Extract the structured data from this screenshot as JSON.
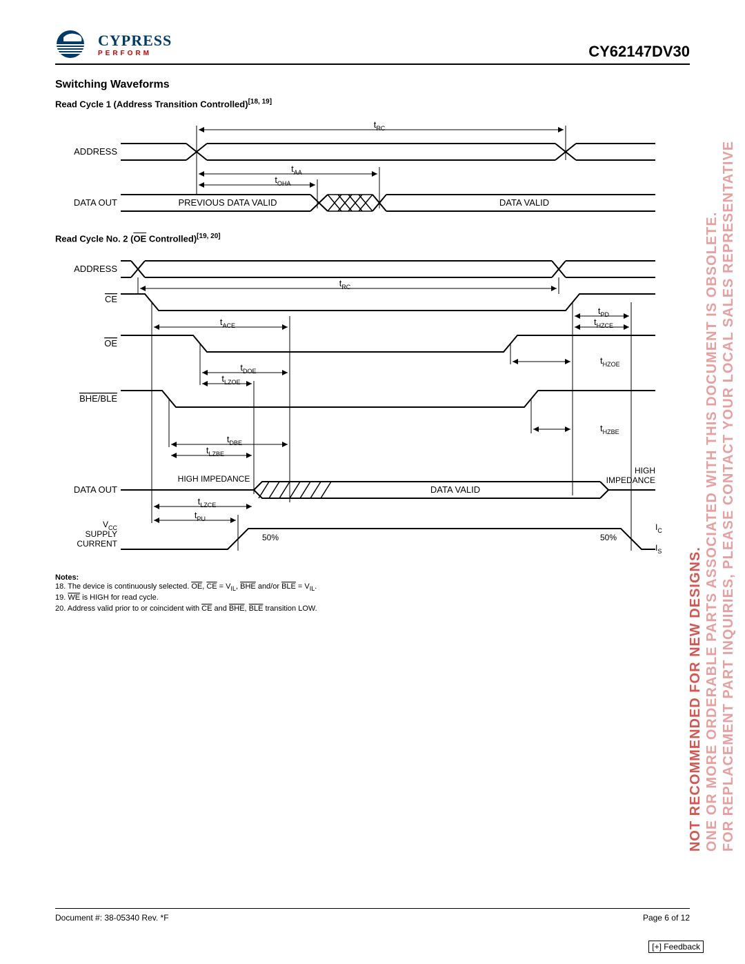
{
  "header": {
    "logo_brand": "CYPRESS",
    "logo_tagline": "PERFORM",
    "part_number": "CY62147DV30"
  },
  "section_title": "Switching Waveforms",
  "cycle1": {
    "title_prefix": "Read Cycle 1 (Address Transition Controlled)",
    "title_refs": "[18, 19]",
    "labels": {
      "address": "ADDRESS",
      "data_out": "DATA OUT",
      "prev_valid": "PREVIOUS DATA VALID",
      "data_valid": "DATA VALID",
      "t_rc": "t",
      "t_rc_sub": "RC",
      "t_aa": "t",
      "t_aa_sub": "AA",
      "t_oha": "t",
      "t_oha_sub": "OHA"
    }
  },
  "cycle2": {
    "title_prefix": "Read Cycle No. 2 (",
    "title_oe": "OE",
    "title_suffix": " Controlled)",
    "title_refs": "[19, 20]",
    "labels": {
      "address": "ADDRESS",
      "ce": "CE",
      "oe": "OE",
      "bhe_ble": "BHE/BLE",
      "data_out": "DATA OUT",
      "vcc": "V",
      "vcc_sub": "CC",
      "supply": "SUPPLY",
      "current": "CURRENT",
      "high_impedance": "HIGH IMPEDANCE",
      "high": "HIGH",
      "impedance": "IMPEDANCE",
      "data_valid": "DATA VALID",
      "fifty": "50%",
      "icc": "I",
      "icc_sub": "CC",
      "isb": "I",
      "isb_sub": "SB",
      "t_rc": "t",
      "t_rc_sub": "RC",
      "t_ace": "t",
      "t_ace_sub": "ACE",
      "t_pd": "t",
      "t_pd_sub": "PD",
      "t_hzce": "t",
      "t_hzce_sub": "HZCE",
      "t_doe": "t",
      "t_doe_sub": "DOE",
      "t_lzoe": "t",
      "t_lzoe_sub": "LZOE",
      "t_hzoe": "t",
      "t_hzoe_sub": "HZOE",
      "t_dbe": "t",
      "t_dbe_sub": "DBE",
      "t_lzbe": "t",
      "t_lzbe_sub": "LZBE",
      "t_hzbe": "t",
      "t_hzbe_sub": "HZBE",
      "t_lzce": "t",
      "t_lzce_sub": "LZCE",
      "t_pu": "t",
      "t_pu_sub": "PU"
    }
  },
  "notes": {
    "title": "Notes:",
    "n18_a": "18. The device is continuously selected. ",
    "n18_oe": "OE",
    "n18_b": ", ",
    "n18_ce": "CE",
    "n18_c": " = V",
    "n18_il": "IL",
    "n18_d": ", ",
    "n18_bhe": "BHE",
    "n18_e": " and/or ",
    "n18_ble": "BLE",
    "n18_f": " = V",
    "n18_il2": "IL",
    "n18_g": ".",
    "n19_a": "19. ",
    "n19_we": "WE",
    "n19_b": " is HIGH for read cycle.",
    "n20_a": "20. Address valid prior to or coincident with ",
    "n20_ce": "CE",
    "n20_b": " and ",
    "n20_bhe": "BHE",
    "n20_c": ", ",
    "n20_ble": "BLE",
    "n20_d": " transition LOW."
  },
  "footer": {
    "doc": "Document #: 38-05340 Rev. *F",
    "page": "Page 6 of 12"
  },
  "feedback": "[+] Feedback",
  "watermark": {
    "line1": "NOT RECOMMENDED FOR NEW DESIGNS.",
    "line2": "ONE OR MORE ORDERABLE PARTS ASSOCIATED WITH THIS DOCUMENT IS OBSOLETE.",
    "line3": "FOR REPLACEMENT PART INQUIRIES, PLEASE CONTACT YOUR LOCAL SALES REPRESENTATIVE"
  }
}
